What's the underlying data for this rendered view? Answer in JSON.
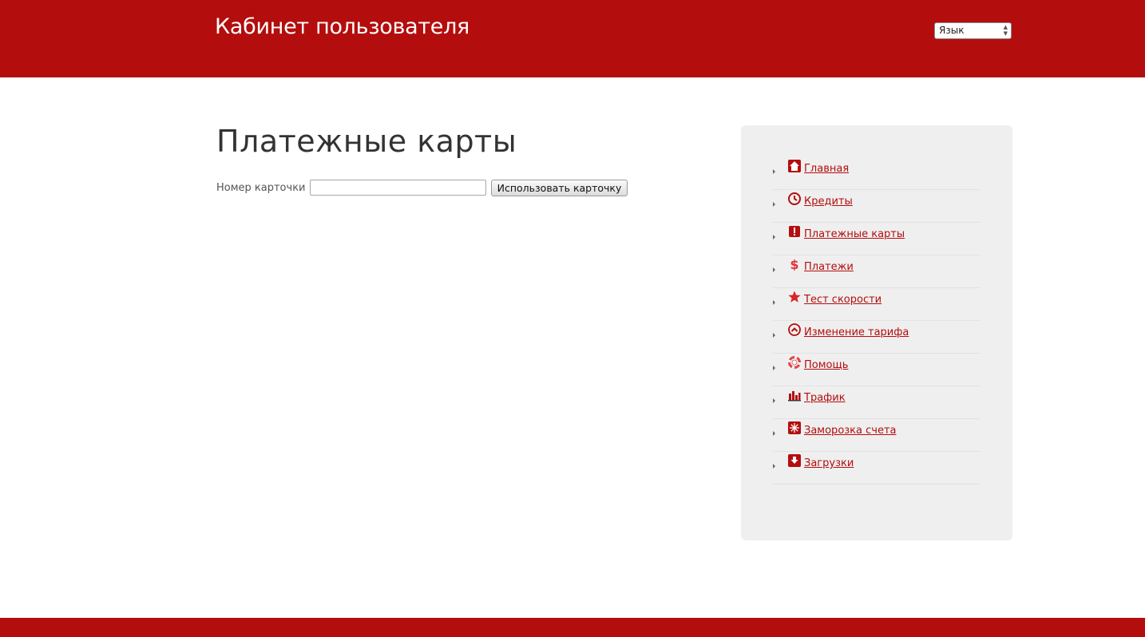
{
  "header": {
    "title": "Кабинет пользователя",
    "language_select": {
      "selected": "Язык"
    },
    "background_color": "#b40d0d"
  },
  "main": {
    "page_title": "Платежные карты",
    "form": {
      "card_number_label": "Номер карточки",
      "card_number_value": "",
      "submit_label": "Использовать карточку"
    }
  },
  "sidebar": {
    "items": [
      {
        "label": "Главная",
        "icon": "home-icon"
      },
      {
        "label": "Кредиты",
        "icon": "clock-icon"
      },
      {
        "label": "Платежные карты",
        "icon": "exclamation-icon"
      },
      {
        "label": "Платежи",
        "icon": "dollar-icon"
      },
      {
        "label": "Тест скорости",
        "icon": "star-icon"
      },
      {
        "label": "Изменение тарифа",
        "icon": "chevron-up-circle-icon"
      },
      {
        "label": "Помощь",
        "icon": "lifebuoy-icon"
      },
      {
        "label": "Трафик",
        "icon": "bar-chart-icon"
      },
      {
        "label": "Заморозка счета",
        "icon": "snowflake-icon"
      },
      {
        "label": "Загрузки",
        "icon": "download-icon"
      }
    ],
    "link_color": "#b40d0d"
  }
}
